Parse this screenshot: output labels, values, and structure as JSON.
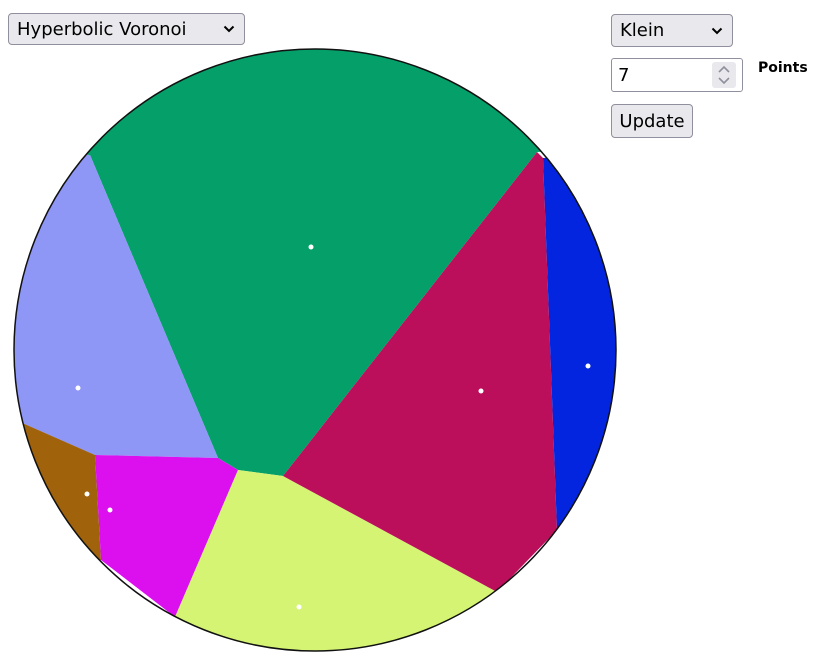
{
  "controls": {
    "algorithm_select": {
      "selected": "Hyperbolic Voronoi"
    },
    "model_select": {
      "selected": "Klein"
    },
    "points_input": {
      "value": "7",
      "label": "Points"
    },
    "update_button": {
      "label": "Update"
    }
  },
  "diagram": {
    "colors": {
      "cell_green": "#05a06a",
      "cell_lavender": "#8e96f6",
      "cell_crimson": "#bb0f5c",
      "cell_blue": "#0325df",
      "cell_brown": "#a0620a",
      "cell_magenta": "#dc10ee",
      "cell_yellow": "#d5f474",
      "site_dot": "#ffffff",
      "boundary": "#111111"
    }
  }
}
